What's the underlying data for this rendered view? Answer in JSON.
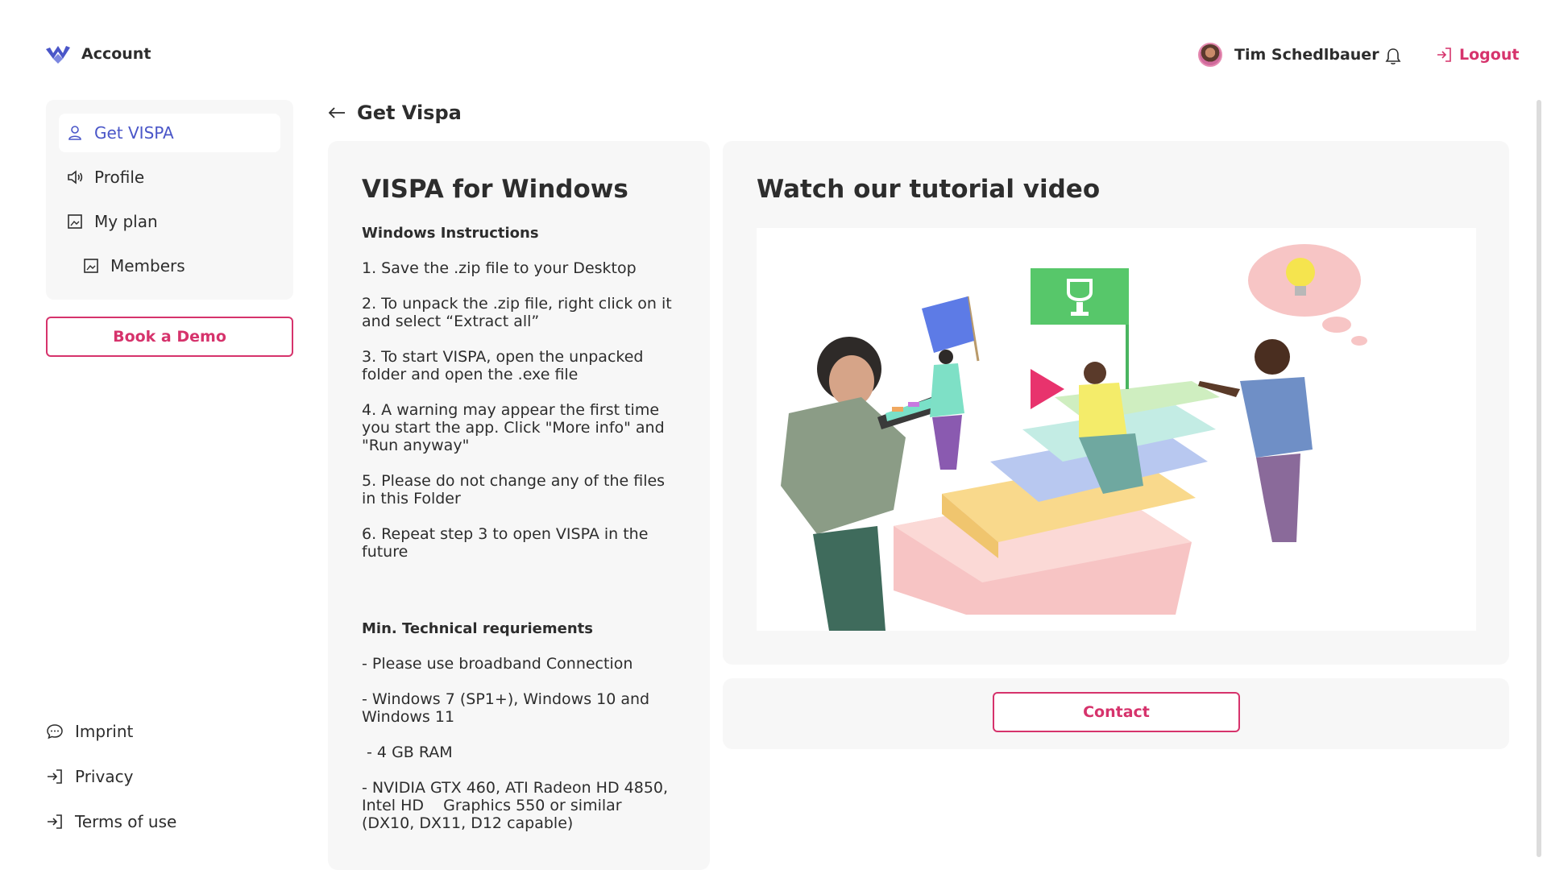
{
  "header": {
    "brand": "Account",
    "user_name": "Tim Schedlbauer",
    "logout": "Logout"
  },
  "sidebar": {
    "items": [
      {
        "label": "Get VISPA",
        "icon": "user-icon",
        "active": true
      },
      {
        "label": "Profile",
        "icon": "speaker-icon"
      },
      {
        "label": "My plan",
        "icon": "image-icon"
      },
      {
        "label": "Members",
        "icon": "image-icon"
      }
    ],
    "demo_button": "Book a Demo",
    "footer": [
      {
        "label": "Imprint",
        "icon": "chat-icon"
      },
      {
        "label": "Privacy",
        "icon": "login-icon"
      },
      {
        "label": "Terms of use",
        "icon": "login-icon"
      }
    ]
  },
  "page": {
    "title": "Get Vispa"
  },
  "instructions": {
    "title": "VISPA for Windows",
    "subtitle": "Windows Instructions",
    "steps": [
      "1. Save the .zip file to your Desktop",
      "2. To unpack the .zip file, right click on it and select “Extract all”",
      "3. To start VISPA, open the unpacked folder and open the .exe file",
      "4. A warning may appear the first time you start the app. Click \"More info\" and \"Run anyway\"",
      "5. Please do not change any of the files in this Folder",
      "6. Repeat step 3 to open VISPA in the future"
    ],
    "req_title": "Min. Technical requriements",
    "requirements": [
      "- Please use broadband Connection",
      "- Windows 7 (SP1+), Windows 10 and Windows 11",
      " - 4 GB RAM",
      "- NVIDIA GTX 460, ATI Radeon HD 4850, Intel HD    Graphics 550 or similar (DX10, DX11, D12 capable)"
    ]
  },
  "video": {
    "title": "Watch our tutorial video"
  },
  "contact": {
    "button": "Contact"
  },
  "colors": {
    "accent": "#d6336c",
    "active_nav": "#4a56c8",
    "card_bg": "#f7f7f7"
  }
}
